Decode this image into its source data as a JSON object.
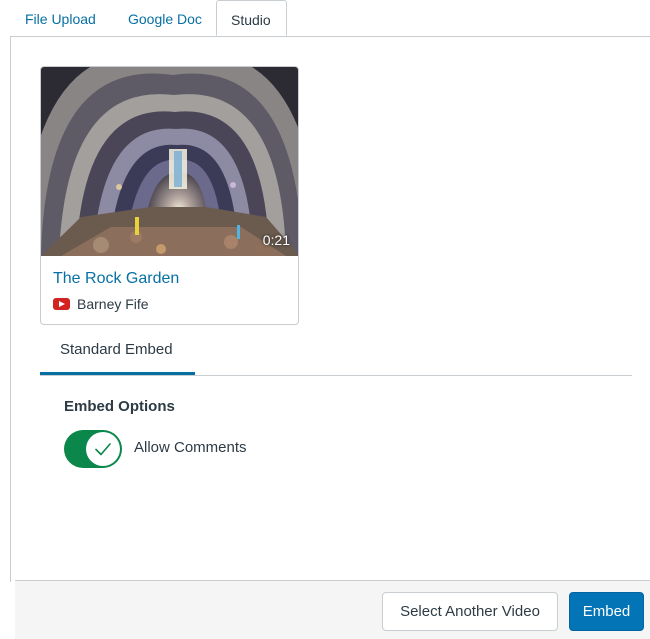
{
  "tabs": [
    {
      "label": "File Upload",
      "active": false
    },
    {
      "label": "Google Doc",
      "active": false
    },
    {
      "label": "Studio",
      "active": true
    }
  ],
  "video": {
    "title": "The Rock Garden",
    "author": "Barney Fife",
    "duration": "0:21",
    "source_icon": "youtube-icon"
  },
  "embed": {
    "tab_label": "Standard Embed",
    "options_title": "Embed Options",
    "allow_comments_label": "Allow Comments",
    "allow_comments_on": true
  },
  "footer": {
    "select_label": "Select Another Video",
    "embed_label": "Embed"
  },
  "colors": {
    "link": "#0770a3",
    "toggle_on": "#0b874b",
    "primary_button": "#0374b5"
  }
}
